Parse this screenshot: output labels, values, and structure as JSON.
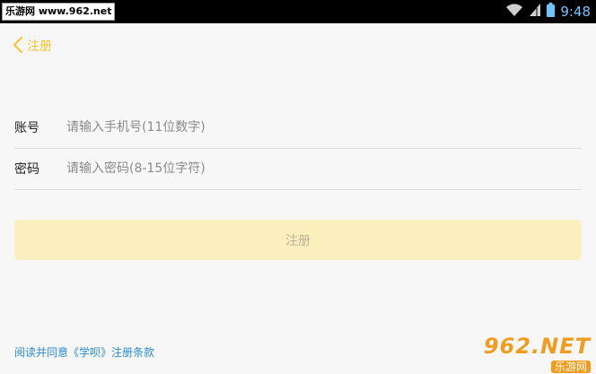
{
  "statusbar": {
    "watermark": "乐游网 www.962.net",
    "time": "9:48",
    "icons": [
      "wifi-icon",
      "signal-icon",
      "battery-icon"
    ]
  },
  "nav": {
    "back_label": "注册",
    "back_icon": "chevron-left-icon"
  },
  "form": {
    "account_label": "账号",
    "account_placeholder": "请输入手机号(11位数字)",
    "password_label": "密码",
    "password_placeholder": "请输入密码(8-15位字符)"
  },
  "submit_label": "注册",
  "agreement_text": "阅读并同意《学呗》注册条款",
  "watermark_br": {
    "logo": "962.NET",
    "name": "乐游网"
  },
  "colors": {
    "accent": "#f7c42a",
    "button_bg": "#fcefbe",
    "link": "#2a8ad6",
    "clock": "#6fc6ff"
  }
}
